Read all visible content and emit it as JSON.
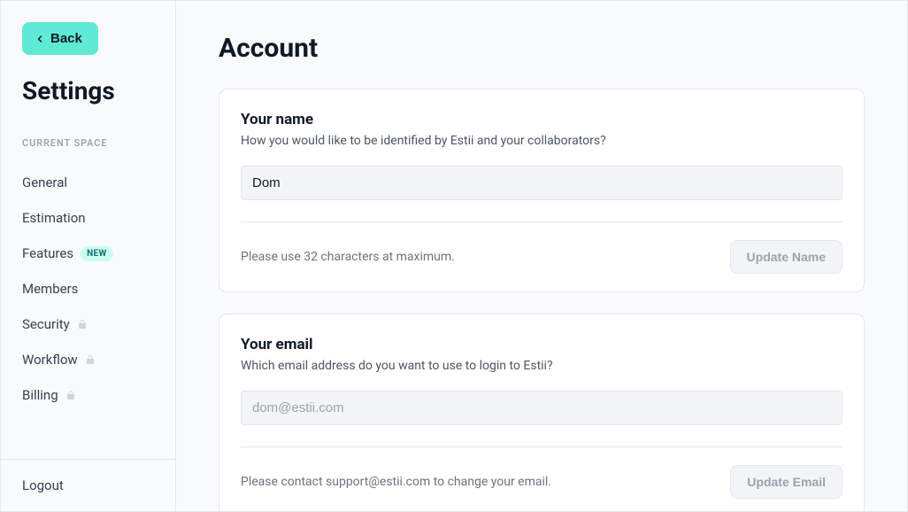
{
  "sidebar": {
    "back_label": "Back",
    "title": "Settings",
    "section_label": "Current Space",
    "items": [
      {
        "label": "General",
        "badge": null,
        "locked": false
      },
      {
        "label": "Estimation",
        "badge": null,
        "locked": false
      },
      {
        "label": "Features",
        "badge": "NEW",
        "locked": false
      },
      {
        "label": "Members",
        "badge": null,
        "locked": false
      },
      {
        "label": "Security",
        "badge": null,
        "locked": true
      },
      {
        "label": "Workflow",
        "badge": null,
        "locked": true
      },
      {
        "label": "Billing",
        "badge": null,
        "locked": true
      }
    ],
    "logout_label": "Logout"
  },
  "page": {
    "title": "Account"
  },
  "name_card": {
    "title": "Your name",
    "subtitle": "How you would like to be identified by Estii and your collaborators?",
    "value": "Dom",
    "hint": "Please use 32 characters at maximum.",
    "button_label": "Update Name"
  },
  "email_card": {
    "title": "Your email",
    "subtitle": "Which email address do you want to use to login to Estii?",
    "value": "dom@estii.com",
    "hint": "Please contact support@estii.com to change your email.",
    "button_label": "Update Email"
  }
}
